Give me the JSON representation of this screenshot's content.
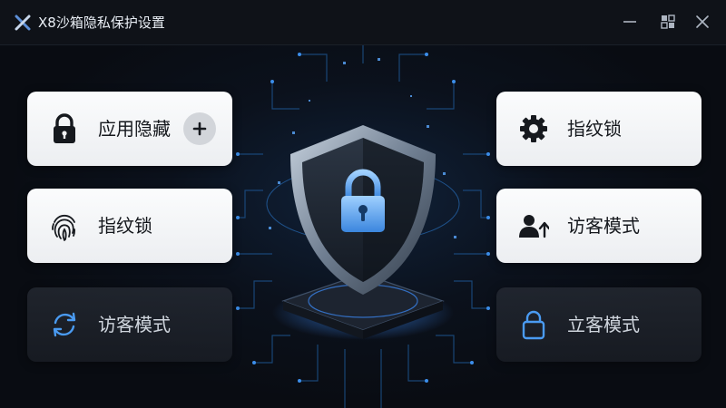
{
  "window": {
    "title": "X8沙箱隐私保护设置",
    "logo_icon": "x8-logo-icon",
    "controls": [
      "minimize-icon",
      "restore-icon",
      "close-icon"
    ]
  },
  "theme": {
    "accent": "#4aa3ff",
    "card_light": "#f3f4f6",
    "card_dark": "#232831",
    "text_dark": "#15181d",
    "text_light": "#cfd5dd"
  },
  "left_cards": [
    {
      "label": "应用隐藏",
      "icon": "lock-icon",
      "has_add": true,
      "add_icon": "plus-icon"
    },
    {
      "label": "指纹锁",
      "icon": "fingerprint-icon"
    },
    {
      "label": "访客模式",
      "icon": "refresh-icon"
    }
  ],
  "right_cards": [
    {
      "label": "指纹锁",
      "icon": "gear-icon"
    },
    {
      "label": "访客模式",
      "icon": "user-upload-icon"
    },
    {
      "label": "立客模式",
      "icon": "lock-outline-icon"
    }
  ],
  "center_graphic": {
    "icon": "shield-lock-icon"
  }
}
